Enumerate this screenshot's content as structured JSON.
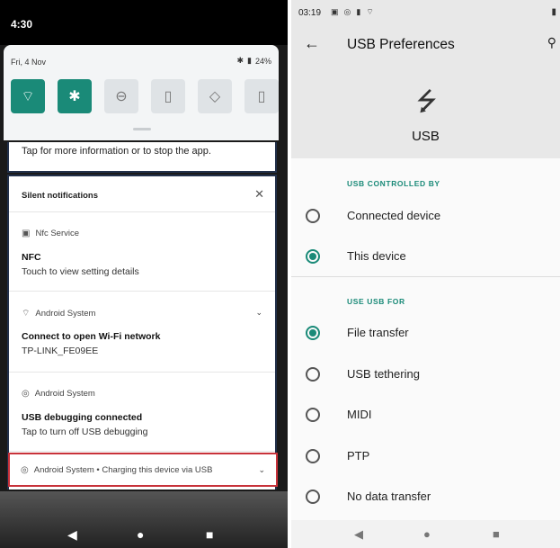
{
  "left": {
    "status_time": "4:30",
    "qs": {
      "date": "Fri, 4 Nov",
      "battery": "24%",
      "tiles": [
        {
          "icon": "wifi-icon",
          "glyph": "⌔",
          "on": true
        },
        {
          "icon": "bluetooth-icon",
          "glyph": "✱",
          "on": true
        },
        {
          "icon": "dnd-icon",
          "glyph": "⊖",
          "on": false
        },
        {
          "icon": "flashlight-icon",
          "glyph": "▯",
          "on": false
        },
        {
          "icon": "rotate-icon",
          "glyph": "◇",
          "on": false
        },
        {
          "icon": "battery-saver-icon",
          "glyph": "▯",
          "on": false
        }
      ]
    },
    "strip_text": "Tap for more information or to stop the app.",
    "silent_title": "Silent notifications",
    "notifications": [
      {
        "app": "Nfc Service",
        "title": "NFC",
        "text": "Touch to view setting details"
      },
      {
        "app": "Android System",
        "title": "Connect to open Wi-Fi network",
        "text": "TP-LINK_FE09EE"
      },
      {
        "app": "Android System",
        "title": "USB debugging connected",
        "text": "Tap to turn off USB debugging"
      }
    ],
    "last_notification": "Android System • Charging this device via USB"
  },
  "right": {
    "status_time": "03:19",
    "title": "USB Preferences",
    "usb_label": "USB",
    "section1": "USB CONTROLLED BY",
    "controlled_by": [
      {
        "label": "Connected device",
        "selected": false
      },
      {
        "label": "This device",
        "selected": true
      }
    ],
    "section2": "USE USB FOR",
    "use_for": [
      {
        "label": "File transfer",
        "selected": true
      },
      {
        "label": "USB tethering",
        "selected": false
      },
      {
        "label": "MIDI",
        "selected": false
      },
      {
        "label": "PTP",
        "selected": false
      },
      {
        "label": "No data transfer",
        "selected": false
      }
    ]
  },
  "colors": {
    "accent": "#1a8a78",
    "highlight_border": "#c8323a"
  }
}
